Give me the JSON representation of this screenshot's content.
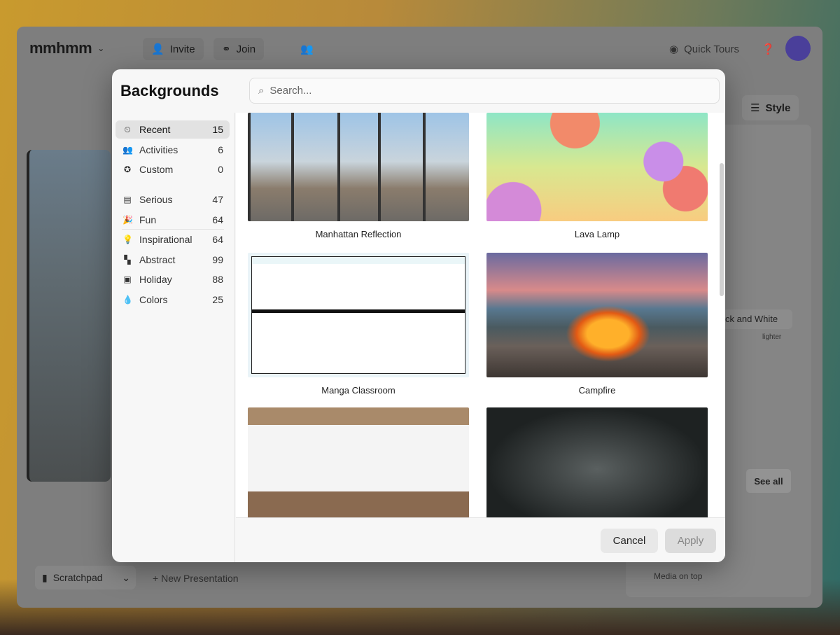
{
  "app": {
    "logo": "mmhmm",
    "invite": "Invite",
    "join": "Join",
    "quick_tours": "Quick Tours",
    "style": "Style",
    "style_select": "ck and White",
    "lighter": "lighter",
    "see_all": "See all",
    "media_on_top": "Media on top",
    "scratchpad": "Scratchpad",
    "new_presentation": "New Presentation"
  },
  "modal": {
    "title": "Backgrounds",
    "search_placeholder": "Search...",
    "categories": [
      {
        "label": "Recent",
        "count": "15",
        "icon": "⏲"
      },
      {
        "label": "Activities",
        "count": "6",
        "icon": "👥"
      },
      {
        "label": "Custom",
        "count": "0",
        "icon": "✪"
      },
      {
        "label": "Serious",
        "count": "47",
        "icon": "▤"
      },
      {
        "label": "Fun",
        "count": "64",
        "icon": "🎉"
      },
      {
        "label": "Inspirational",
        "count": "64",
        "icon": "💡"
      },
      {
        "label": "Abstract",
        "count": "99",
        "icon": "▚"
      },
      {
        "label": "Holiday",
        "count": "88",
        "icon": "▣"
      },
      {
        "label": "Colors",
        "count": "25",
        "icon": "💧"
      }
    ],
    "backgrounds": [
      {
        "name": "Manhattan Reflection"
      },
      {
        "name": "Lava Lamp"
      },
      {
        "name": "Manga Classroom"
      },
      {
        "name": "Campfire"
      },
      {
        "name": ""
      },
      {
        "name": ""
      }
    ],
    "cancel": "Cancel",
    "apply": "Apply"
  }
}
